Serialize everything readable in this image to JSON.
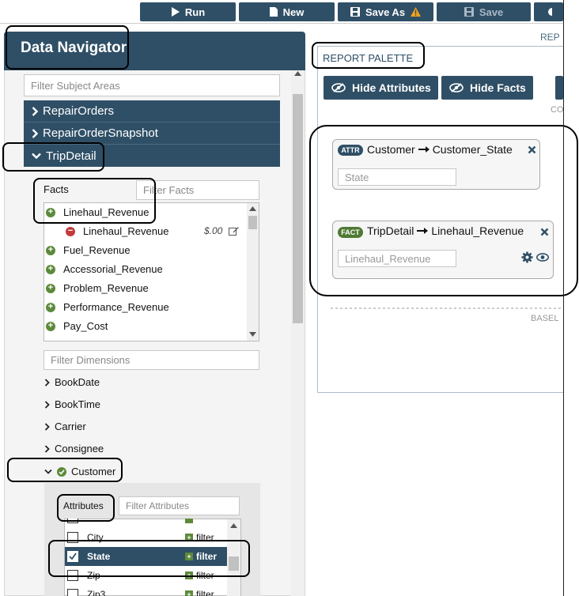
{
  "toolbar": {
    "run": "Run",
    "new": "New",
    "save_as": "Save As",
    "save": "Save",
    "warning_icon_color": "#f0a01c"
  },
  "navigator": {
    "title": "Data Navigator",
    "filter_subject_areas_placeholder": "Filter Subject Areas",
    "subject_areas": [
      {
        "label": "RepairOrders",
        "expanded": false
      },
      {
        "label": "RepairOrderSnapshot",
        "expanded": false
      },
      {
        "label": "TripDetail",
        "expanded": true
      }
    ],
    "facts_label": "Facts",
    "filter_facts_placeholder": "Filter Facts",
    "facts": [
      {
        "label": "Linehaul_Revenue",
        "selected": true
      },
      {
        "label": "Linehaul_Revenue",
        "sub": true,
        "value": "$.00"
      },
      {
        "label": "Fuel_Revenue"
      },
      {
        "label": "Accessorial_Revenue"
      },
      {
        "label": "Problem_Revenue"
      },
      {
        "label": "Performance_Revenue"
      },
      {
        "label": "Pay_Cost"
      }
    ],
    "filter_dimensions_placeholder": "Filter Dimensions",
    "dimensions": [
      {
        "label": "BookDate"
      },
      {
        "label": "BookTime"
      },
      {
        "label": "Carrier"
      },
      {
        "label": "Consignee"
      },
      {
        "label": "Customer",
        "expanded": true
      }
    ],
    "attributes_label": "Attributes",
    "filter_attributes_placeholder": "Filter Attributes",
    "filter_word": "filter",
    "attributes": [
      {
        "label": "City",
        "checked": false
      },
      {
        "label": "State",
        "checked": true
      },
      {
        "label": "Zip",
        "checked": false
      },
      {
        "label": "Zip3",
        "checked": false
      }
    ]
  },
  "palette": {
    "rep_label": "REP",
    "title": "REPORT PALETTE",
    "hide_attributes": "Hide Attributes",
    "hide_facts": "Hide Facts",
    "co_label": "CO",
    "basel_label": "BASEL",
    "attr_card": {
      "badge": "ATTR",
      "source": "Customer",
      "target": "Customer_State",
      "input_value": "State"
    },
    "fact_card": {
      "badge": "FACT",
      "source": "TripDetail",
      "target": "Linehaul_Revenue",
      "input_value": "Linehaul_Revenue"
    }
  },
  "colors": {
    "navy": "#2f4f66",
    "green": "#5c8a3a",
    "red": "#c23b3b",
    "attr_badge": "#2f4f66",
    "fact_badge": "#4f7a34"
  }
}
